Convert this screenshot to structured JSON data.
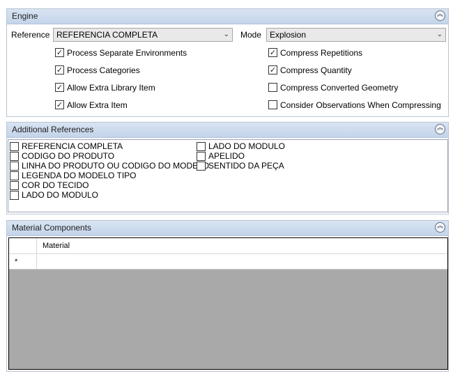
{
  "engine": {
    "title": "Engine",
    "reference_label": "Reference",
    "reference_value": "REFERENCIA COMPLETA",
    "mode_label": "Mode",
    "mode_value": "Explosion",
    "options_left": [
      {
        "label": "Process Separate Environments",
        "checked": true
      },
      {
        "label": "Process Categories",
        "checked": true
      },
      {
        "label": "Allow Extra Library Item",
        "checked": true
      },
      {
        "label": "Allow Extra Item",
        "checked": true
      }
    ],
    "options_right": [
      {
        "label": "Compress Repetitions",
        "checked": true
      },
      {
        "label": "Compress Quantity",
        "checked": true
      },
      {
        "label": "Compress Converted Geometry",
        "checked": false
      },
      {
        "label": "Consider Observations When Compressing",
        "checked": false
      }
    ]
  },
  "additional_references": {
    "title": "Additional References",
    "col1": [
      "REFERENCIA COMPLETA",
      "CODIGO DO PRODUTO",
      "LINHA DO PRODUTO OU CODIGO DO MODELO",
      "LEGENDA DO MODELO TIPO",
      "COR DO TECIDO",
      "LADO DO MODULO"
    ],
    "col2": [
      "LADO DO MODULO",
      "APELIDO",
      "SENTIDO DA PEÇA"
    ]
  },
  "material_components": {
    "title": "Material Components",
    "column_header": "Material",
    "new_row_marker": "*"
  },
  "icons": {
    "collapse": "chevron-double-up-icon",
    "dropdown": "chevron-down-icon",
    "check": "check-icon"
  }
}
